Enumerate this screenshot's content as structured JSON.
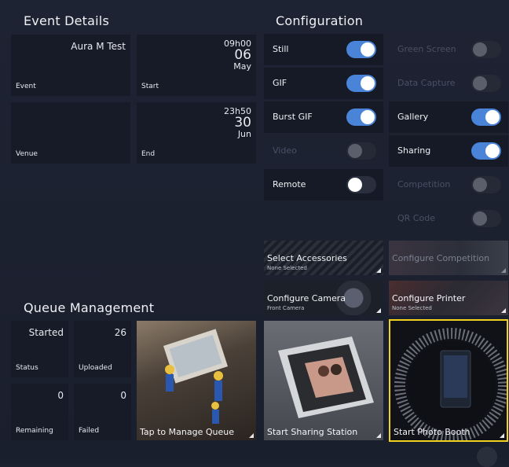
{
  "event_details": {
    "header": "Event Details",
    "event": {
      "label": "Event",
      "value": "Aura M Test"
    },
    "start": {
      "label": "Start",
      "time": "09h00",
      "day": "06",
      "month": "May"
    },
    "venue": {
      "label": "Venue",
      "value": ""
    },
    "end": {
      "label": "End",
      "time": "23h50",
      "day": "30",
      "month": "Jun"
    }
  },
  "configuration": {
    "header": "Configuration",
    "left": [
      {
        "label": "Still",
        "state": "on",
        "enabled": true
      },
      {
        "label": "GIF",
        "state": "on",
        "enabled": true
      },
      {
        "label": "Burst GIF",
        "state": "on",
        "enabled": true
      },
      {
        "label": "Video",
        "state": "off",
        "enabled": false
      },
      {
        "label": "Remote",
        "state": "off",
        "enabled": true
      }
    ],
    "right": [
      {
        "label": "Green Screen",
        "state": "off",
        "enabled": false
      },
      {
        "label": "Data Capture",
        "state": "off",
        "enabled": false
      },
      {
        "label": "Gallery",
        "state": "on",
        "enabled": true
      },
      {
        "label": "Sharing",
        "state": "on",
        "enabled": true
      },
      {
        "label": "Competition",
        "state": "off",
        "enabled": false
      },
      {
        "label": "QR Code",
        "state": "off",
        "enabled": false
      }
    ]
  },
  "actions": {
    "select_accessories": {
      "title": "Select Accessories",
      "subtitle": "None Selected"
    },
    "configure_competition": {
      "title": "Configure Competition"
    },
    "configure_camera": {
      "title": "Configure Camera",
      "subtitle": "Front Camera"
    },
    "configure_printer": {
      "title": "Configure Printer",
      "subtitle": "None Selected"
    }
  },
  "queue": {
    "header": "Queue Management",
    "status": {
      "label": "Status",
      "value": "Started"
    },
    "uploaded": {
      "label": "Uploaded",
      "value": "26"
    },
    "remaining": {
      "label": "Remaining",
      "value": "0"
    },
    "failed": {
      "label": "Failed",
      "value": "0"
    },
    "manage": {
      "title": "Tap to Manage Queue"
    }
  },
  "launch": {
    "sharing_station": {
      "title": "Start Sharing Station"
    },
    "photo_booth": {
      "title": "Start Photo Booth"
    }
  },
  "colors": {
    "accent": "#4a84d8",
    "selected_border": "#f2d01e",
    "tile": "#171b28"
  }
}
